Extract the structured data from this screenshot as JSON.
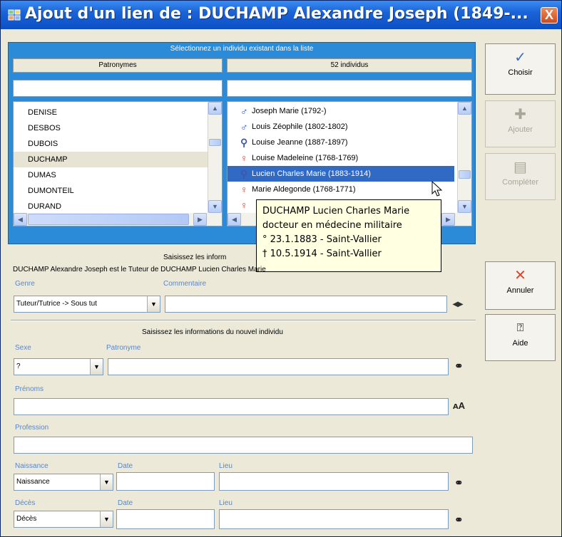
{
  "window": {
    "title": "Ajout d'un lien de : DUCHAMP Alexandre Joseph (1849-...",
    "close_label": "X"
  },
  "selection": {
    "header": "Sélectionnez un individu existant dans la liste",
    "surname_column": "Patronymes",
    "individuals_column": "52 individus",
    "surnames": [
      "DENISE",
      "DESBOS",
      "DUBOIS",
      "DUCHAMP",
      "DUMAS",
      "DUMONTEIL",
      "DURAND"
    ],
    "selected_surname": "DUCHAMP",
    "individuals": [
      {
        "name": "Joseph Marie (1792-)",
        "sex": "male"
      },
      {
        "name": "Louis Zéophile (1802-1802)",
        "sex": "male"
      },
      {
        "name": "Louise Jeanne (1887-1897)",
        "sex": "unknown"
      },
      {
        "name": "Louise Madeleine (1768-1769)",
        "sex": "female"
      },
      {
        "name": "Lucien Charles Marie (1883-1914)",
        "sex": "unknown"
      },
      {
        "name": "Marie Aldegonde (1768-1771)",
        "sex": "female"
      },
      {
        "name": "",
        "sex": "female"
      }
    ],
    "selected_individual": "Lucien Charles Marie (1883-1914)"
  },
  "tooltip": {
    "line1": "DUCHAMP Lucien Charles Marie",
    "line2": "docteur en médecine militaire",
    "line3": "° 23.1.1883 - Saint-Vallier",
    "line4": "† 10.5.1914 - Saint-Vallier"
  },
  "link_info": {
    "header": "Saisissez les inform",
    "description": "DUCHAMP Alexandre Joseph est le Tuteur de DUCHAMP Lucien Charles Marie",
    "genre_label": "Genre",
    "genre_value": "Tuteur/Tutrice -> Sous tut",
    "comment_label": "Commentaire",
    "comment_value": ""
  },
  "new_individual": {
    "header": "Saisissez les informations du nouvel individu",
    "sex_label": "Sexe",
    "sex_value": "?",
    "surname_label": "Patronyme",
    "surname_value": "",
    "firstname_label": "Prénoms",
    "firstname_value": "",
    "profession_label": "Profession",
    "profession_value": "",
    "birth_label": "Naissance",
    "birth_value": "Naissance",
    "birth_date_label": "Date",
    "birth_place_label": "Lieu",
    "death_label": "Décès",
    "death_value": "Décès",
    "death_date_label": "Date",
    "death_place_label": "Lieu"
  },
  "side_buttons": {
    "choose": "Choisir",
    "add": "Ajouter",
    "complete": "Compléter",
    "cancel": "Annuler",
    "help": "Aide"
  },
  "icons": {
    "choose": "check-icon",
    "add": "plus-icon",
    "complete": "form-icon",
    "cancel": "x-icon",
    "help": "help-icon",
    "search": "binoculars-icon",
    "swap": "swap-arrows-icon"
  },
  "colors": {
    "titlebar": "#1b63d8",
    "selection_panel": "#2b8bd8",
    "label_blue": "#5a87c8",
    "selected_row": "#316ac5",
    "male": "#1f4fb8",
    "female": "#d43a2a",
    "cancel_icon": "#e0462a"
  }
}
